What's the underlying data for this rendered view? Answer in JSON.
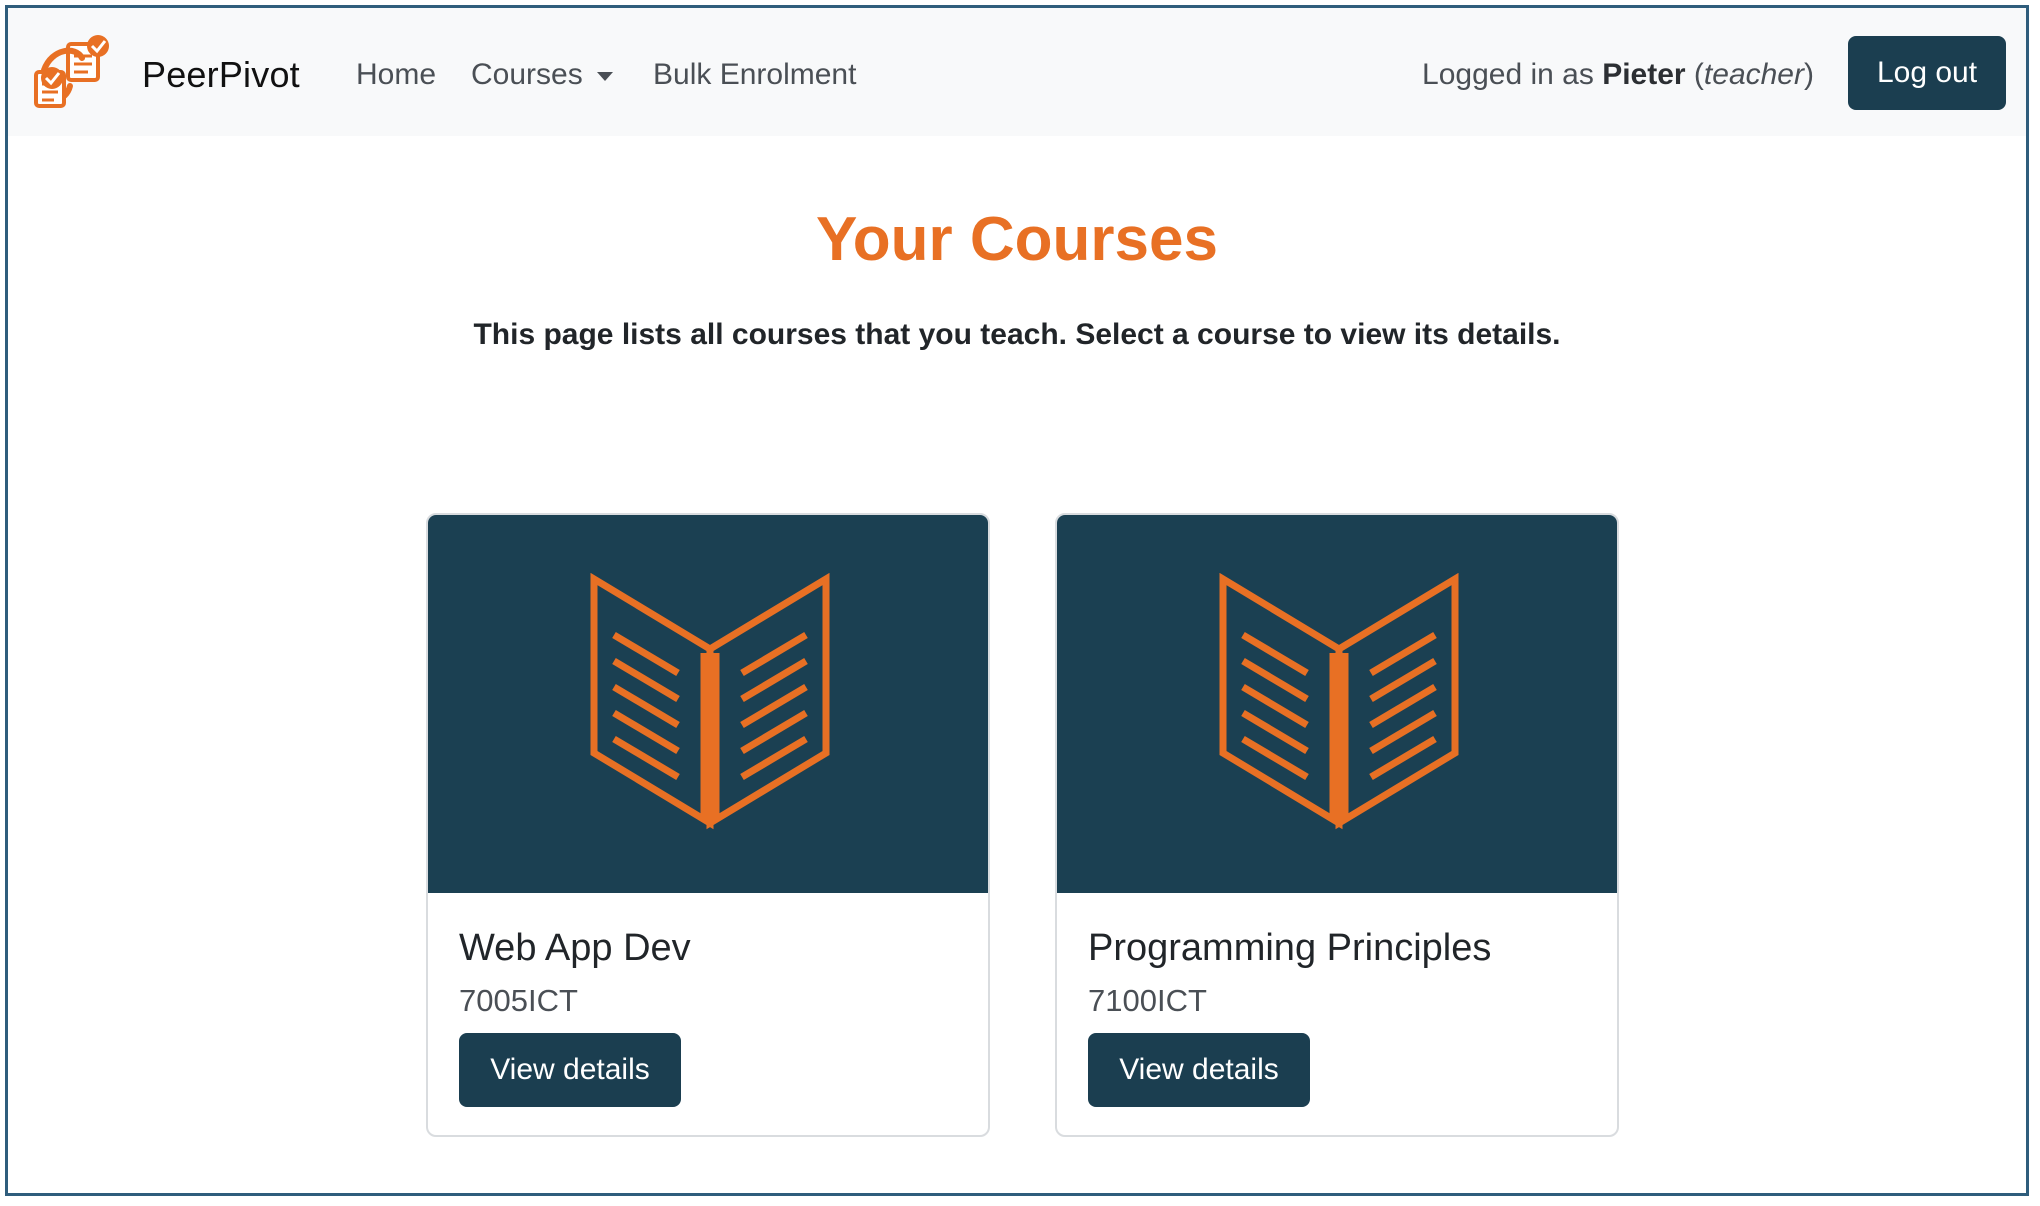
{
  "navbar": {
    "brand": "PeerPivot",
    "links": [
      {
        "label": "Home"
      },
      {
        "label": "Courses"
      },
      {
        "label": "Bulk Enrolment"
      }
    ],
    "user": {
      "prefix": "Logged in as ",
      "name": "Pieter",
      "role_open": " (",
      "role": "teacher",
      "role_close": ")"
    },
    "logout_label": "Log out"
  },
  "page": {
    "title": "Your Courses",
    "subtitle": "This page lists all courses that you teach. Select a course to view its details."
  },
  "courses": [
    {
      "name": "Web App Dev",
      "code": "7005ICT",
      "button": "View details"
    },
    {
      "name": "Programming Principles",
      "code": "7100ICT",
      "button": "View details"
    }
  ],
  "colors": {
    "accent": "#e87024",
    "primary": "#1b3e50",
    "card_image_bg": "#1b4052",
    "navbar_bg": "#f8f9fa"
  },
  "icons": {
    "brand": "peerpivot-logo-icon",
    "course": "open-book-icon",
    "dropdown": "caret-down-icon"
  }
}
